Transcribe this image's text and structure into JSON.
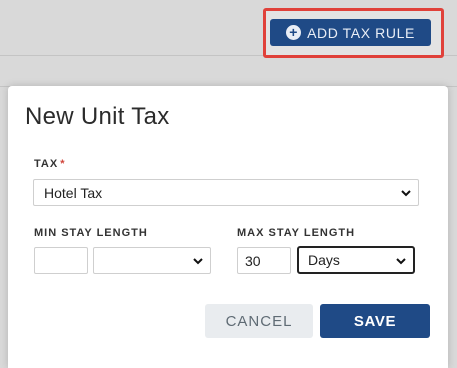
{
  "background": {
    "add_tax_rule_label": "ADD TAX RULE"
  },
  "modal": {
    "title": "New Unit Tax",
    "tax": {
      "label": "TAX",
      "required_marker": "*",
      "selected": "Hotel Tax"
    },
    "min_stay": {
      "label": "MIN STAY LENGTH",
      "value": "",
      "unit": ""
    },
    "max_stay": {
      "label": "MAX STAY LENGTH",
      "value": "30",
      "unit": "Days"
    },
    "buttons": {
      "cancel": "CANCEL",
      "save": "SAVE"
    }
  },
  "colors": {
    "primary": "#1f4a86",
    "highlight": "#e0413a",
    "required": "#d0443a"
  },
  "icons": {
    "add": "plus-circle-icon",
    "dropdown": "chevron-down-icon"
  }
}
